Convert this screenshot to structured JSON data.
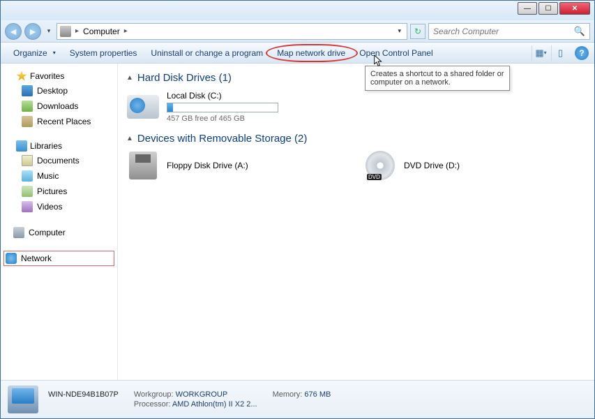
{
  "breadcrumb": {
    "root": "Computer"
  },
  "search": {
    "placeholder": "Search Computer"
  },
  "toolbar": {
    "organize": "Organize",
    "sysprops": "System properties",
    "uninstall": "Uninstall or change a program",
    "mapdrive": "Map network drive",
    "controlpanel": "Open Control Panel"
  },
  "tooltip": "Creates a shortcut to a shared folder or computer on a network.",
  "sidebar": {
    "favorites": "Favorites",
    "desktop": "Desktop",
    "downloads": "Downloads",
    "recent": "Recent Places",
    "libraries": "Libraries",
    "documents": "Documents",
    "music": "Music",
    "pictures": "Pictures",
    "videos": "Videos",
    "computer": "Computer",
    "network": "Network"
  },
  "sections": {
    "hdd": "Hard Disk Drives (1)",
    "removable": "Devices with Removable Storage (2)"
  },
  "drives": {
    "local": {
      "name": "Local Disk (C:)",
      "free": "457 GB free of 465 GB",
      "fill_pct": 5
    },
    "floppy": {
      "name": "Floppy Disk Drive (A:)"
    },
    "dvd": {
      "name": "DVD Drive (D:)"
    }
  },
  "status": {
    "computer_name": "WIN-NDE94B1B07P",
    "workgroup_label": "Workgroup:",
    "workgroup": "WORKGROUP",
    "processor_label": "Processor:",
    "processor": "AMD Athlon(tm) II X2 2...",
    "memory_label": "Memory:",
    "memory": "676 MB"
  }
}
